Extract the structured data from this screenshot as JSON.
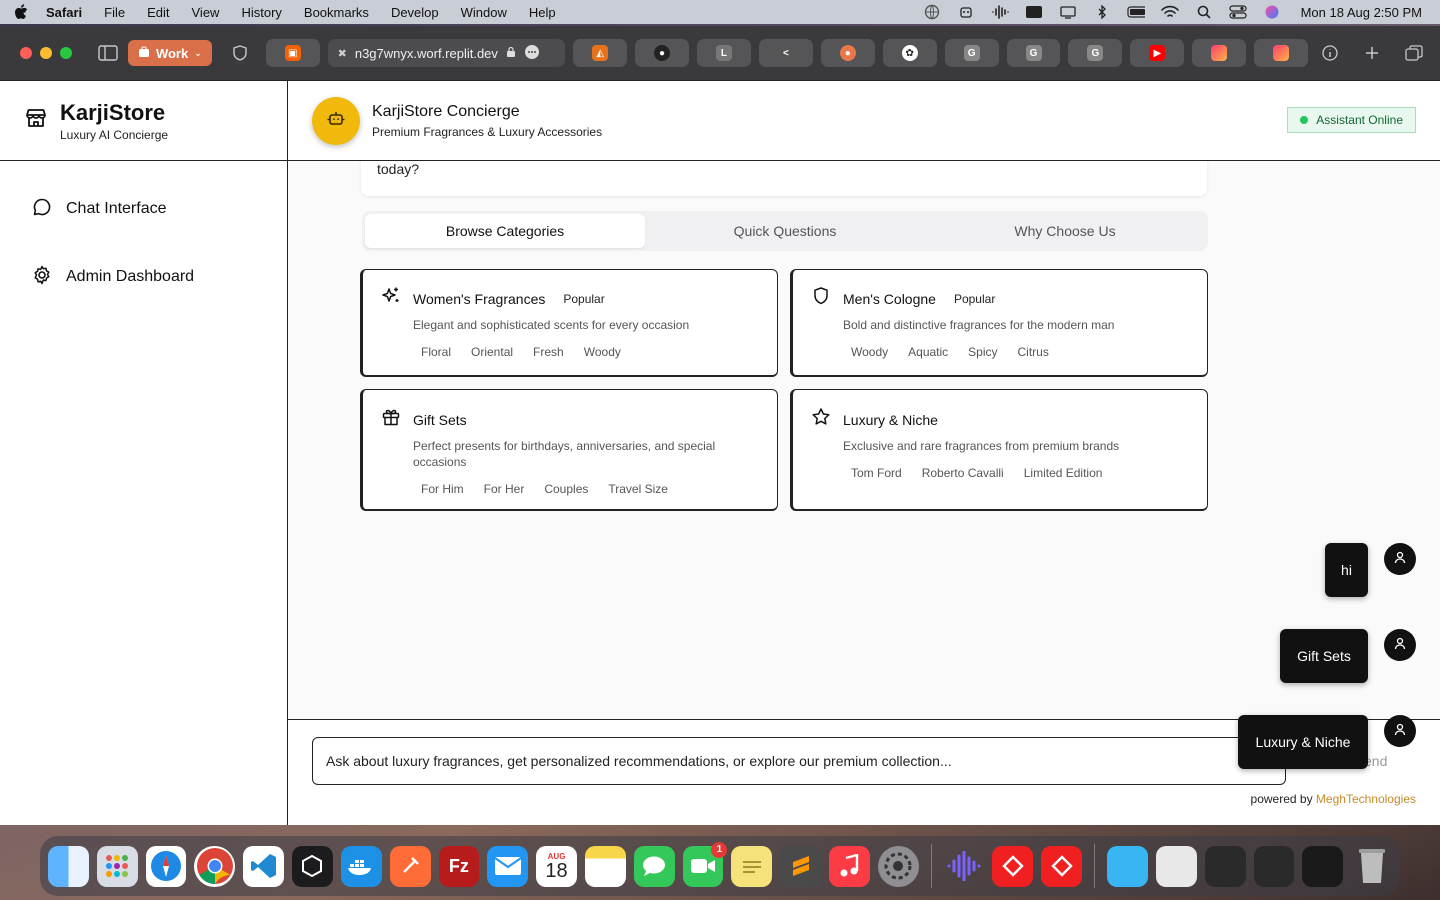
{
  "menubar": {
    "app_name": "Safari",
    "items": [
      "File",
      "Edit",
      "View",
      "History",
      "Bookmarks",
      "Develop",
      "Window",
      "Help"
    ],
    "clock": "Mon 18 Aug  2:50 PM"
  },
  "browser": {
    "profile_label": "Work",
    "url": "n3g7wnyx.worf.replit.dev",
    "tab_letters": [
      "L",
      "G",
      "G",
      "G"
    ]
  },
  "sidebar": {
    "brand_title": "KarjiStore",
    "brand_subtitle": "Luxury AI Concierge",
    "items": [
      {
        "label": "Chat Interface",
        "icon": "chat-bubble-icon"
      },
      {
        "label": "Admin Dashboard",
        "icon": "gear-icon"
      }
    ]
  },
  "header": {
    "title": "KarjiStore Concierge",
    "subtitle": "Premium Fragrances & Luxury Accessories",
    "status": "Assistant Online"
  },
  "welcome_tail": "today?",
  "tabs": [
    "Browse Categories",
    "Quick Questions",
    "Why Choose Us"
  ],
  "categories": [
    {
      "title": "Women's Fragrances",
      "badge": "Popular",
      "icon": "sparkles-icon",
      "description": "Elegant and sophisticated scents for every occasion",
      "tags": [
        "Floral",
        "Oriental",
        "Fresh",
        "Woody"
      ]
    },
    {
      "title": "Men's Cologne",
      "badge": "Popular",
      "icon": "shield-icon",
      "description": "Bold and distinctive fragrances for the modern man",
      "tags": [
        "Woody",
        "Aquatic",
        "Spicy",
        "Citrus"
      ]
    },
    {
      "title": "Gift Sets",
      "badge": "",
      "icon": "gift-icon",
      "description": "Perfect presents for birthdays, anniversaries, and special occasions",
      "tags": [
        "For Him",
        "For Her",
        "Couples",
        "Travel Size"
      ]
    },
    {
      "title": "Luxury & Niche",
      "badge": "",
      "icon": "star-icon",
      "description": "Exclusive and rare fragrances from premium brands",
      "tags": [
        "Tom Ford",
        "Roberto Cavalli",
        "Limited Edition"
      ]
    }
  ],
  "messages": [
    "hi",
    "Gift Sets",
    "Luxury & Niche"
  ],
  "input": {
    "placeholder": "Ask about luxury fragrances, get personalized recommendations, or explore our premium collection...",
    "send_label": "end"
  },
  "footer": {
    "prefix": "powered by",
    "brand": "MeghTechnologies"
  },
  "dock": {
    "calendar_month": "AUG",
    "calendar_day": "18",
    "facetime_badge": "1"
  },
  "colors": {
    "accent_gold": "#f0b90b",
    "online_green": "#22c55e",
    "brand_link": "#c58a2a",
    "work_button": "#d9704a"
  }
}
